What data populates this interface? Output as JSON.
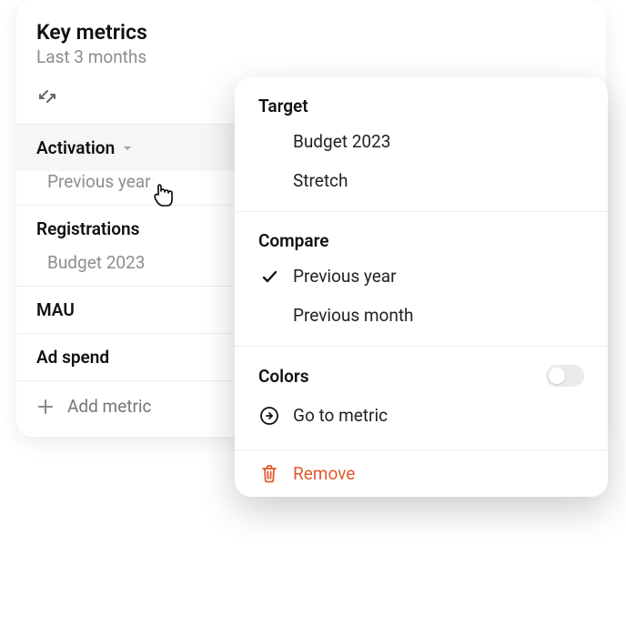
{
  "panel": {
    "title": "Key metrics",
    "subtitle": "Last 3 months",
    "add_label": "Add metric"
  },
  "metrics": [
    {
      "name": "Activation",
      "sub": "Previous year",
      "active": true
    },
    {
      "name": "Registrations",
      "sub": "Budget 2023",
      "active": false
    },
    {
      "name": "MAU",
      "sub": null,
      "active": false
    },
    {
      "name": "Ad spend",
      "sub": null,
      "active": false
    }
  ],
  "popover": {
    "target": {
      "heading": "Target",
      "items": [
        "Budget 2023",
        "Stretch"
      ]
    },
    "compare": {
      "heading": "Compare",
      "items": [
        {
          "label": "Previous year",
          "checked": true
        },
        {
          "label": "Previous month",
          "checked": false
        }
      ]
    },
    "colors": {
      "heading": "Colors",
      "enabled": false
    },
    "goto_label": "Go to metric",
    "remove_label": "Remove"
  },
  "colors": {
    "accent_remove": "#e25a2c"
  }
}
